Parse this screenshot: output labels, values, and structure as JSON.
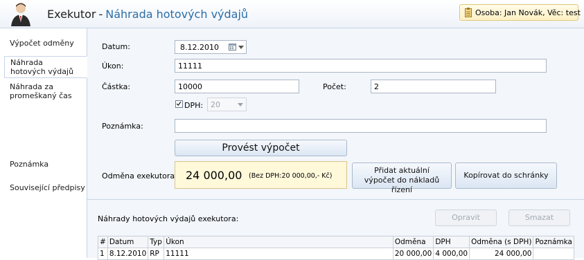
{
  "header": {
    "app_name": "Exekutor",
    "separator": "-",
    "page_title": "Náhrada hotových výdajů",
    "person_info": "Osoba: Jan Novák, Věc: test"
  },
  "sidebar": {
    "items": [
      {
        "label": "Výpočet odměny"
      },
      {
        "label": "Náhrada hotových výdajů"
      },
      {
        "label": "Náhrada za promeškaný čas"
      },
      {
        "label": "Poznámka"
      },
      {
        "label": "Související předpisy"
      }
    ]
  },
  "form": {
    "datum_label": "Datum:",
    "datum_value": "8.12.2010",
    "ukon_label": "Úkon:",
    "ukon_value": "11111",
    "castka_label": "Částka:",
    "castka_value": "10000",
    "pocet_label": "Počet:",
    "pocet_value": "2",
    "dph_label": "DPH:",
    "dph_checked": true,
    "dph_value": "20",
    "poznamka_label": "Poznámka:",
    "poznamka_value": "",
    "calculate_button": "Provést výpočet",
    "odmena_label": "Odměna exekutora:",
    "odmena_value": "24 000,00",
    "odmena_bez_dph": "(Bez DPH:20 000,00,- Kč)",
    "add_button": "Přidat aktuální výpočet do nákladů řízení",
    "copy_button": "Kopírovat do schránky"
  },
  "list": {
    "title": "Náhrady hotových výdajů exekutora:",
    "edit_button": "Opravit",
    "delete_button": "Smazat",
    "columns": [
      "#",
      "Datum",
      "Typ",
      "Úkon",
      "Odměna",
      "DPH",
      "Odměna (s DPH)",
      "Poznámka"
    ],
    "rows": [
      [
        "1",
        "8.12.2010",
        "RP",
        "11111",
        "20 000,00",
        "4 000,00",
        "24 000,00",
        ""
      ]
    ]
  }
}
